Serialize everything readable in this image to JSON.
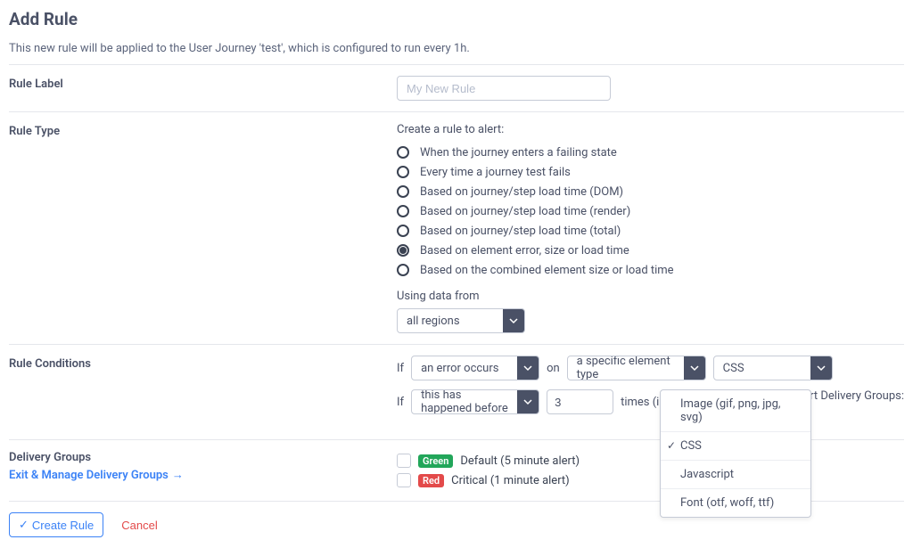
{
  "title": "Add Rule",
  "subhead": "This new rule will be applied to the User Journey 'test', which is configured to run every 1h.",
  "labels": {
    "rule_label": "Rule Label",
    "rule_type": "Rule Type",
    "rule_conditions": "Rule Conditions",
    "delivery_groups": "Delivery Groups"
  },
  "rule_label_placeholder": "My New Rule",
  "rule_type": {
    "intro": "Create a rule to alert:",
    "options": [
      "When the journey enters a failing state",
      "Every time a journey test fails",
      "Based on journey/step load time (DOM)",
      "Based on journey/step load time (render)",
      "Based on journey/step load time (total)",
      "Based on element error, size or load time",
      "Based on the combined element size or load time"
    ],
    "selected_index": 5,
    "using_label": "Using data from",
    "using_value": "all regions"
  },
  "conditions": {
    "if": "If",
    "on": "on",
    "sel1": "an error occurs",
    "sel2": "a specific element type",
    "sel3": "CSS",
    "if2": "If",
    "sel4": "this has happened before",
    "num": "3",
    "times_prefix": "times (in a r",
    "alert_groups": "Alert Delivery Groups:",
    "dropdown": {
      "items": [
        "Image (gif, png, jpg, svg)",
        "CSS",
        "Javascript",
        "Font (otf, woff, ttf)"
      ],
      "selected_index": 1
    }
  },
  "delivery": {
    "link": "Exit & Manage Delivery Groups",
    "groups": [
      {
        "badge": "Green",
        "badge_class": "badge-green",
        "label": "Default (5 minute alert)"
      },
      {
        "badge": "Red",
        "badge_class": "badge-red",
        "label": "Critical (1 minute alert)"
      }
    ]
  },
  "footer": {
    "create": "Create Rule",
    "cancel": "Cancel"
  }
}
